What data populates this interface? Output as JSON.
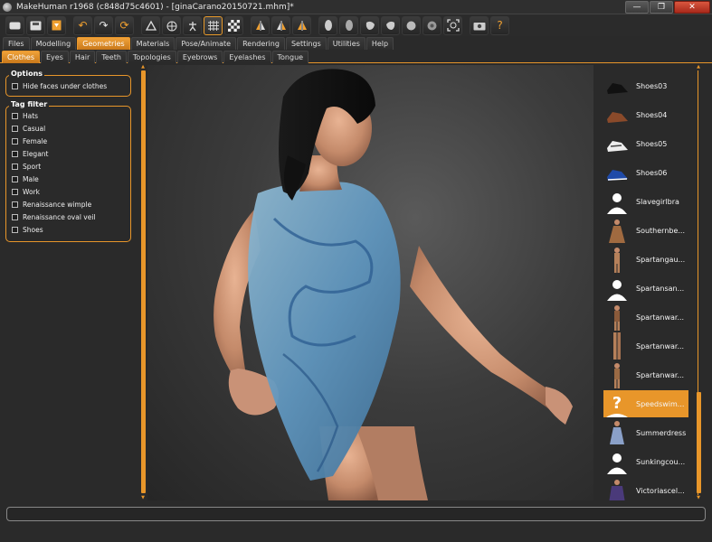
{
  "window": {
    "title": "MakeHuman r1968 (c848d75c4601) - [ginaCarano20150721.mhm]*",
    "controls": [
      "—",
      "❐",
      "✕"
    ]
  },
  "toolbar": {
    "buttons": [
      {
        "icon": "undo-icon",
        "glyph": "↶"
      },
      {
        "icon": "redo-icon",
        "glyph": "↷"
      },
      {
        "icon": "reset-icon",
        "glyph": "⟳"
      }
    ],
    "help_glyph": "?"
  },
  "main_tabs": [
    "Files",
    "Modelling",
    "Geometries",
    "Materials",
    "Pose/Animate",
    "Rendering",
    "Settings",
    "Utilities",
    "Help"
  ],
  "main_tabs_active": "Geometries",
  "sub_tabs": [
    "Clothes",
    "Eyes",
    "Hair",
    "Teeth",
    "Topologies",
    "Eyebrows",
    "Eyelashes",
    "Tongue"
  ],
  "sub_tabs_active": "Clothes",
  "options": {
    "title": "Options",
    "hide_faces": "Hide faces under clothes"
  },
  "tag_filter": {
    "title": "Tag filter",
    "tags": [
      "Hats",
      "Casual",
      "Female",
      "Elegant",
      "Sport",
      "Male",
      "Work",
      "Renaissance wimple",
      "Renaissance oval veil",
      "Shoes"
    ]
  },
  "files": [
    {
      "label": "Shoes03",
      "thumb": "black-shoe",
      "selected": false
    },
    {
      "label": "Shoes04",
      "thumb": "brown-shoe",
      "selected": false
    },
    {
      "label": "Shoes05",
      "thumb": "white-sneaker",
      "selected": false
    },
    {
      "label": "Shoes06",
      "thumb": "blue-sneaker",
      "selected": false
    },
    {
      "label": "Slavegirlbra",
      "thumb": "placeholder",
      "selected": false
    },
    {
      "label": "Southernbe...",
      "thumb": "figure-dress",
      "selected": false
    },
    {
      "label": "Spartangau...",
      "thumb": "figure",
      "selected": false
    },
    {
      "label": "Spartansan...",
      "thumb": "placeholder",
      "selected": false
    },
    {
      "label": "Spartanwar...",
      "thumb": "figure",
      "selected": false
    },
    {
      "label": "Spartanwar...",
      "thumb": "figure-legs",
      "selected": false
    },
    {
      "label": "Spartanwar...",
      "thumb": "figure",
      "selected": false
    },
    {
      "label": "Speedswim...",
      "thumb": "question",
      "selected": true
    },
    {
      "label": "Summerdress",
      "thumb": "figure-dress",
      "selected": false
    },
    {
      "label": "Sunkingcou...",
      "thumb": "placeholder",
      "selected": false
    },
    {
      "label": "Victoriascel...",
      "thumb": "figure-dark",
      "selected": false
    }
  ],
  "colors": {
    "accent": "#e8962a",
    "background": "#2a2a2a",
    "close_button": "#c0392b"
  }
}
